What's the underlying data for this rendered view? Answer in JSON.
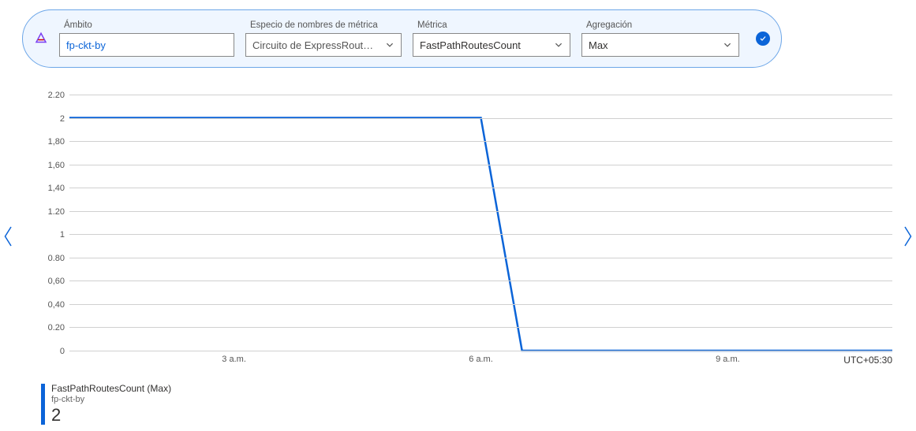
{
  "toolbar": {
    "scope": {
      "label": "Ámbito",
      "value": "fp-ckt-by"
    },
    "namespace": {
      "label": "Especio de nombres de métrica",
      "value": "Circuito de ExpressRoute…"
    },
    "metric": {
      "label": "Métrica",
      "value": "FastPathRoutesCount"
    },
    "aggregation": {
      "label": "Agregación",
      "value": "Max"
    }
  },
  "chart_data": {
    "type": "line",
    "title": "",
    "xlabel": "",
    "ylabel": "",
    "ylim": [
      0,
      2.2
    ],
    "yticks": [
      2.2,
      2,
      1.8,
      1.6,
      1.4,
      1.2,
      1,
      0.8,
      0.6,
      0.4,
      0.2,
      0
    ],
    "ytick_labels": [
      "2.20",
      "2",
      "1,80",
      "1,60",
      "1,40",
      "1.20",
      "1",
      "0.80",
      "0,60",
      "0,40",
      "0.20",
      "0"
    ],
    "xticks": [
      3,
      6,
      9
    ],
    "xtick_labels": [
      "3 a.m.",
      "6 a.m.",
      "9 a.m."
    ],
    "xlim": [
      1,
      11
    ],
    "timezone": "UTC+05:30",
    "series": [
      {
        "name": "FastPathRoutesCount (Max)",
        "resource": "fp-ckt-by",
        "current": 2,
        "color": "#0b64d8",
        "points": [
          {
            "x": 1.0,
            "y": 2
          },
          {
            "x": 6.0,
            "y": 2
          },
          {
            "x": 6.5,
            "y": 0
          },
          {
            "x": 11.0,
            "y": 0
          }
        ]
      }
    ]
  }
}
